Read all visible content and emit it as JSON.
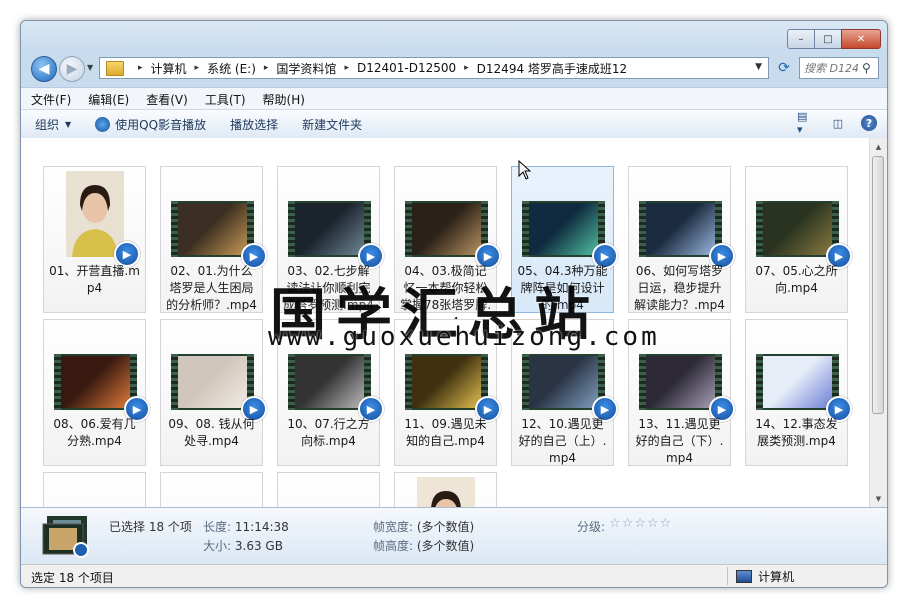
{
  "window": {
    "controls": {
      "minimize": "–",
      "maximize": "□",
      "close": "✕"
    }
  },
  "nav": {
    "back": "◀",
    "forward": "▶"
  },
  "address": {
    "crumbs": [
      "计算机",
      "系统 (E:)",
      "国学资料馆",
      "D12401-D12500",
      "D12494 塔罗高手速成班12"
    ],
    "search_placeholder": "搜索 D124..."
  },
  "menu": [
    "文件(F)",
    "编辑(E)",
    "查看(V)",
    "工具(T)",
    "帮助(H)"
  ],
  "toolbar": {
    "organize": "组织",
    "play_qq": "使用QQ影音播放",
    "play_selected": "播放选择",
    "new_folder": "新建文件夹"
  },
  "files": [
    {
      "name": "01、开营直播.mp4",
      "kind": "portrait"
    },
    {
      "name": "02、01.为什么塔罗是人生困局的分析师？.mp4",
      "kind": "film"
    },
    {
      "name": "03、02.七步解读法让你顺利完成塔罗预测.mp4",
      "kind": "film"
    },
    {
      "name": "04、03.极简记忆一本帮你轻松掌握78张塔罗牌.mp4",
      "kind": "film"
    },
    {
      "name": "05、04.3种万能牌阵是如何设计的.mp4",
      "kind": "film"
    },
    {
      "name": "06、如何写塔罗日运，稳步提升解读能力？.mp4",
      "kind": "film"
    },
    {
      "name": "07、05.心之所向.mp4",
      "kind": "film"
    },
    {
      "name": "08、06.爱有几分熟.mp4",
      "kind": "film"
    },
    {
      "name": "09、08. 钱从何处寻.mp4",
      "kind": "film"
    },
    {
      "name": "10、07.行之方向标.mp4",
      "kind": "film"
    },
    {
      "name": "11、09.遇见未知的自己.mp4",
      "kind": "film"
    },
    {
      "name": "12、10.遇见更好的自己（上）.mp4",
      "kind": "film"
    },
    {
      "name": "13、11.遇见更好的自己（下）.mp4",
      "kind": "film"
    },
    {
      "name": "14、12.事态发展类预测.mp4",
      "kind": "film"
    },
    {
      "name": "",
      "kind": "film"
    },
    {
      "name": "",
      "kind": "film"
    },
    {
      "name": "",
      "kind": "film"
    },
    {
      "name": "",
      "kind": "portrait"
    }
  ],
  "watermark": {
    "cn": "国学汇总站",
    "en": "www.guoxuehuizong.com"
  },
  "details": {
    "selected": "已选择 18 个项",
    "length_label": "长度:",
    "length": "11:14:38",
    "size_label": "大小:",
    "size": "3.63 GB",
    "frame_width_label": "帧宽度:",
    "frame_width": "(多个数值)",
    "frame_height_label": "帧高度:",
    "frame_height": "(多个数值)",
    "rating_label": "分级:",
    "rating_stars": "☆☆☆☆☆"
  },
  "status": {
    "left": "选定 18 个项目",
    "right": "计算机"
  },
  "colors": {
    "accent": "#1c66b8",
    "badge": "#1f5fb0",
    "hover_tile": "#d7e8f8"
  }
}
